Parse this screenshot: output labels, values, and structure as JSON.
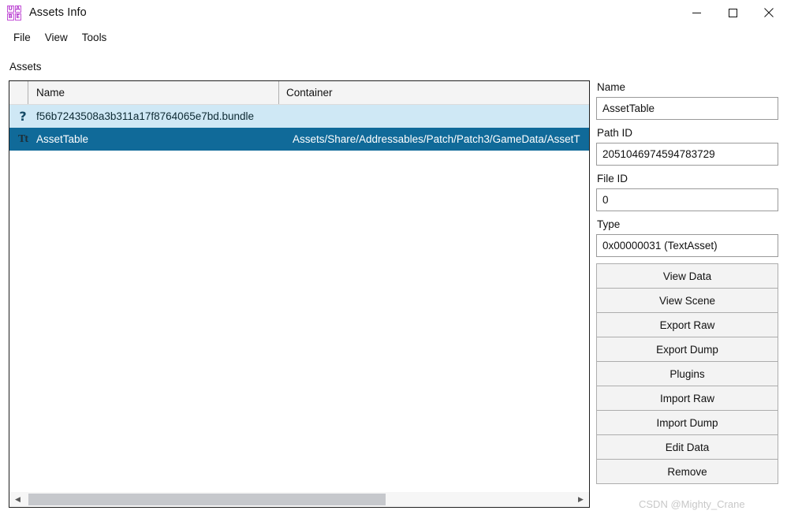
{
  "window": {
    "title": "Assets Info",
    "icon_name": "uabe-icon",
    "icon_letters": [
      "U",
      "A",
      "B",
      "E"
    ],
    "icon_color": "#b63fd0",
    "controls": {
      "minimize": "minimize-icon",
      "maximize": "maximize-icon",
      "close": "close-icon"
    }
  },
  "menubar": {
    "items": [
      {
        "label": "File"
      },
      {
        "label": "View"
      },
      {
        "label": "Tools"
      }
    ]
  },
  "assets_section": {
    "label": "Assets",
    "columns": [
      {
        "key": "icon",
        "label": ""
      },
      {
        "key": "name",
        "label": "Name"
      },
      {
        "key": "container",
        "label": "Container"
      }
    ],
    "rows": [
      {
        "icon": "?",
        "icon_name": "unknown-asset-icon",
        "name": "f56b7243508a3b311a17f8764065e7bd.bundle",
        "container": "",
        "state": "highlighted"
      },
      {
        "icon": "Tt",
        "icon_name": "text-asset-icon",
        "name": "AssetTable",
        "container": "Assets/Share/Addressables/Patch/Patch3/GameData/AssetT",
        "state": "selected"
      }
    ],
    "scrollbar": {
      "left_arrow": "scroll-left-icon",
      "right_arrow": "scroll-right-icon"
    },
    "colors": {
      "row_highlight": "#cfe8f5",
      "row_selected": "#106a99"
    }
  },
  "details": {
    "fields": [
      {
        "label": "Name",
        "value": "AssetTable"
      },
      {
        "label": "Path ID",
        "value": "2051046974594783729"
      },
      {
        "label": "File ID",
        "value": "0"
      },
      {
        "label": "Type",
        "value": "0x00000031 (TextAsset)"
      }
    ],
    "buttons": [
      {
        "label": "View Data"
      },
      {
        "label": "View Scene"
      },
      {
        "label": "Export Raw"
      },
      {
        "label": "Export Dump"
      },
      {
        "label": "Plugins"
      },
      {
        "label": "Import Raw"
      },
      {
        "label": "Import Dump"
      },
      {
        "label": "Edit Data"
      },
      {
        "label": "Remove"
      }
    ]
  },
  "watermark": {
    "text": "CSDN @Mighty_Crane"
  }
}
